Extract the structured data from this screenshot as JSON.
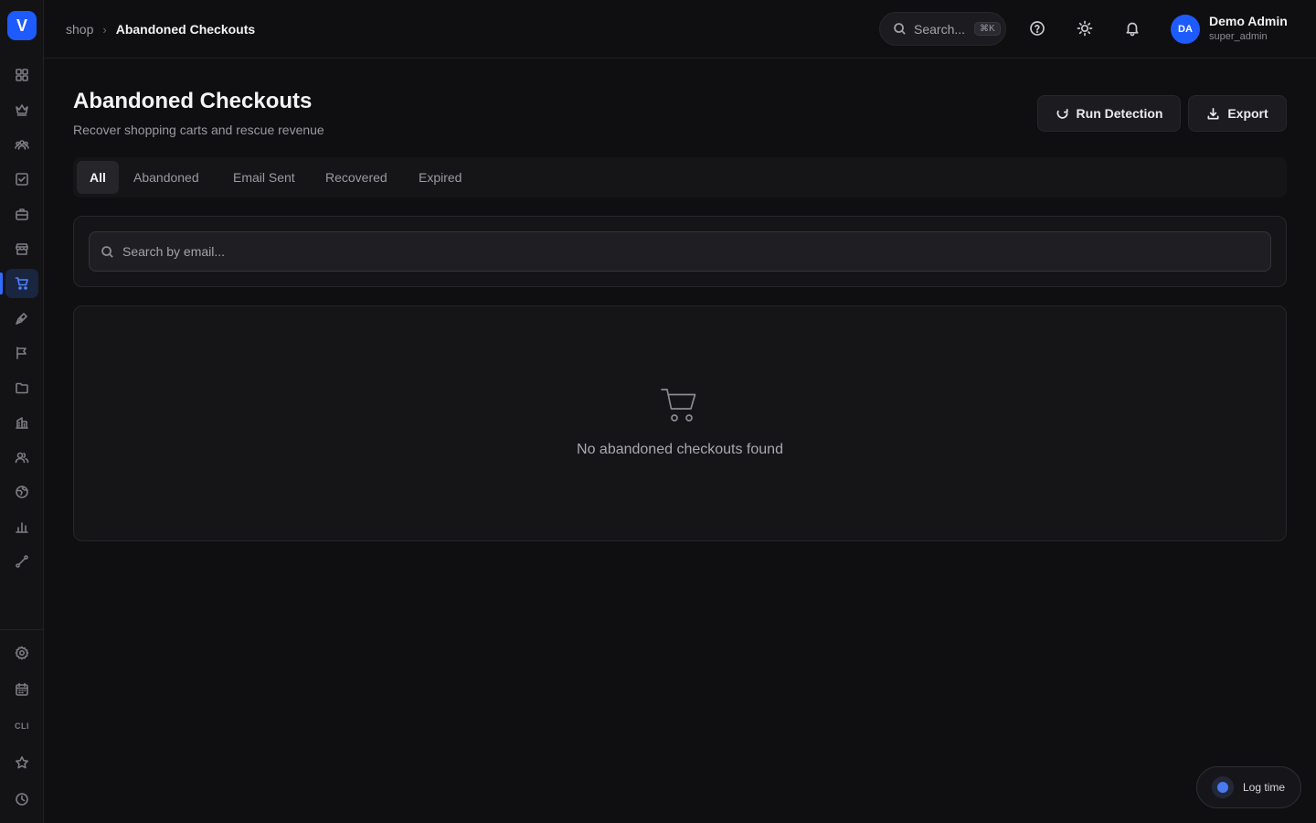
{
  "app": {
    "logo_letter": "V",
    "brand_color": "#1e5bff"
  },
  "breadcrumb": {
    "root": "shop",
    "separator": "›",
    "current": "Abandoned Checkouts"
  },
  "topbar": {
    "search_label": "Search...",
    "search_kbd": "⌘K",
    "icons": [
      "help-icon",
      "sun-icon",
      "bell-icon"
    ]
  },
  "user": {
    "initials": "DA",
    "name": "Demo Admin",
    "role": "super_admin"
  },
  "sidebar": {
    "items": [
      "dashboard-icon",
      "crown-icon",
      "team-icon",
      "tasks-icon",
      "briefcase-icon",
      "store-icon",
      "cart-icon",
      "pen-icon",
      "campaign-icon",
      "folder-icon",
      "building-icon",
      "users-icon",
      "globe-icon",
      "bar-chart-icon",
      "route-icon"
    ],
    "active_item": "cart-icon",
    "bottom_items": [
      "settings-icon",
      "calendar-icon",
      "cli",
      "star-icon",
      "clock-icon"
    ],
    "cli_label": "CLI"
  },
  "page": {
    "title": "Abandoned Checkouts",
    "subtitle": "Recover shopping carts and rescue revenue"
  },
  "actions": {
    "run_detection": "Run Detection",
    "export": "Export"
  },
  "tabs": [
    {
      "label": "All",
      "active": true
    },
    {
      "label": "Abandoned",
      "active": false
    },
    {
      "label": "Email Sent",
      "active": false
    },
    {
      "label": "Recovered",
      "active": false
    },
    {
      "label": "Expired",
      "active": false
    }
  ],
  "filter": {
    "search_placeholder": "Search by email...",
    "search_value": ""
  },
  "empty_state": {
    "icon": "cart-icon",
    "message": "No abandoned checkouts found"
  },
  "floating": {
    "log_time_label": "Log time"
  }
}
